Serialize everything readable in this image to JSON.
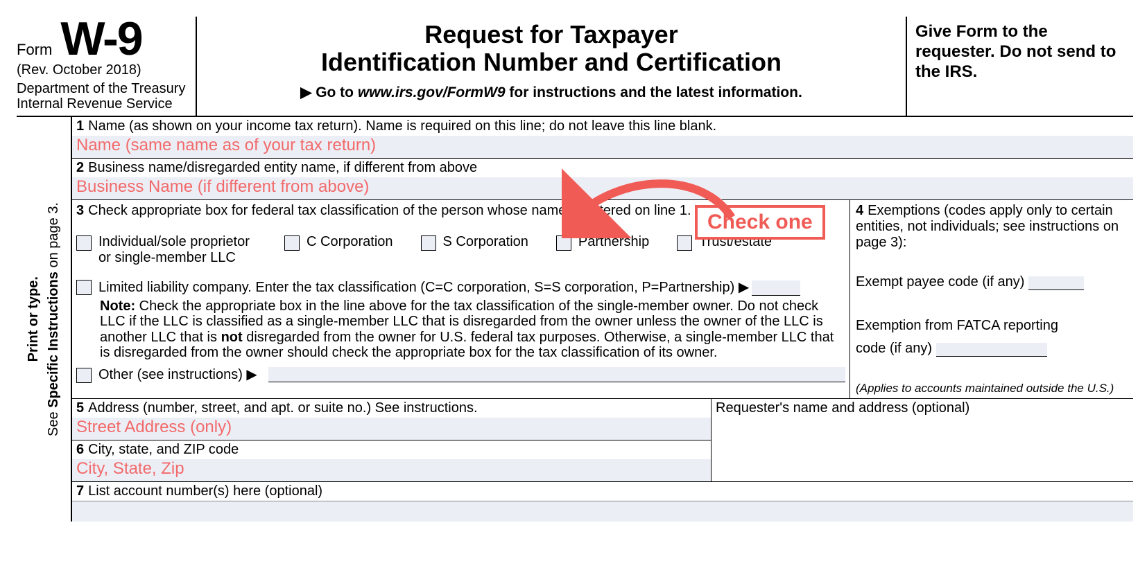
{
  "header": {
    "form_word": "Form",
    "form_code": "W-9",
    "revision": "(Rev. October 2018)",
    "department": "Department of the Treasury\nInternal Revenue Service",
    "title_line1": "Request for Taxpayer",
    "title_line2": "Identification Number and Certification",
    "goto_prefix": "▶ Go to ",
    "goto_url": "www.irs.gov/FormW9",
    "goto_suffix": " for instructions and the latest information.",
    "right_text": "Give Form to the requester. Do not send to the IRS."
  },
  "sidebar": {
    "line1": "Print or type.",
    "line2_a": "See ",
    "line2_b": "Specific Instructions",
    "line2_c": " on page 3."
  },
  "lines": {
    "l1_num": "1",
    "l1_label": "Name (as shown on your income tax return). Name is required on this line; do not leave this line blank.",
    "l1_fill": "Name (same name as of your tax return)",
    "l2_num": "2",
    "l2_label": "Business name/disregarded entity name, if different from above",
    "l2_fill": "Business Name (if different from above)",
    "l3_num": "3",
    "l3_label": "Check appropriate box for federal tax classification of the person whose name is entered on line 1.",
    "l4_num": "4",
    "l4_label": "Exemptions (codes apply only to certain entities, not individuals; see instructions on page 3):",
    "l4_exempt_payee": "Exempt payee code (if any)",
    "l4_fatca1": "Exemption from FATCA reporting",
    "l4_fatca2": "code (if any)",
    "l4_applies": "(Applies to accounts maintained outside the U.S.)",
    "l5_num": "5",
    "l5_label": "Address (number, street, and apt. or suite no.) See instructions.",
    "l5_fill": "Street Address (only)",
    "l6_num": "6",
    "l6_label": "City, state, and ZIP code",
    "l6_fill": "City, State, Zip",
    "requester_label": "Requester's name and address (optional)",
    "l7_num": "7",
    "l7_label": "List account number(s) here (optional)"
  },
  "checkboxes": {
    "individual": "Individual/sole proprietor or single-member LLC",
    "c_corp": "C Corporation",
    "s_corp": "S Corporation",
    "partnership": "Partnership",
    "trust": "Trust/estate",
    "llc": "Limited liability company. Enter the tax classification (C=C corporation, S=S corporation, P=Partnership) ▶",
    "note_bold": "Note:",
    "note_text_a": " Check the appropriate box in the line above for the tax classification of the single-member owner.  Do not check LLC if the LLC is classified as a single-member LLC that is disregarded from the owner unless the owner of the LLC is another LLC that is ",
    "note_not": "not",
    "note_text_b": " disregarded from the owner for U.S. federal tax purposes. Otherwise, a single-member LLC that is disregarded from the owner should check the appropriate box for the tax classification of its owner.",
    "other": "Other (see instructions) ▶"
  },
  "callout": {
    "text": "Check one"
  }
}
